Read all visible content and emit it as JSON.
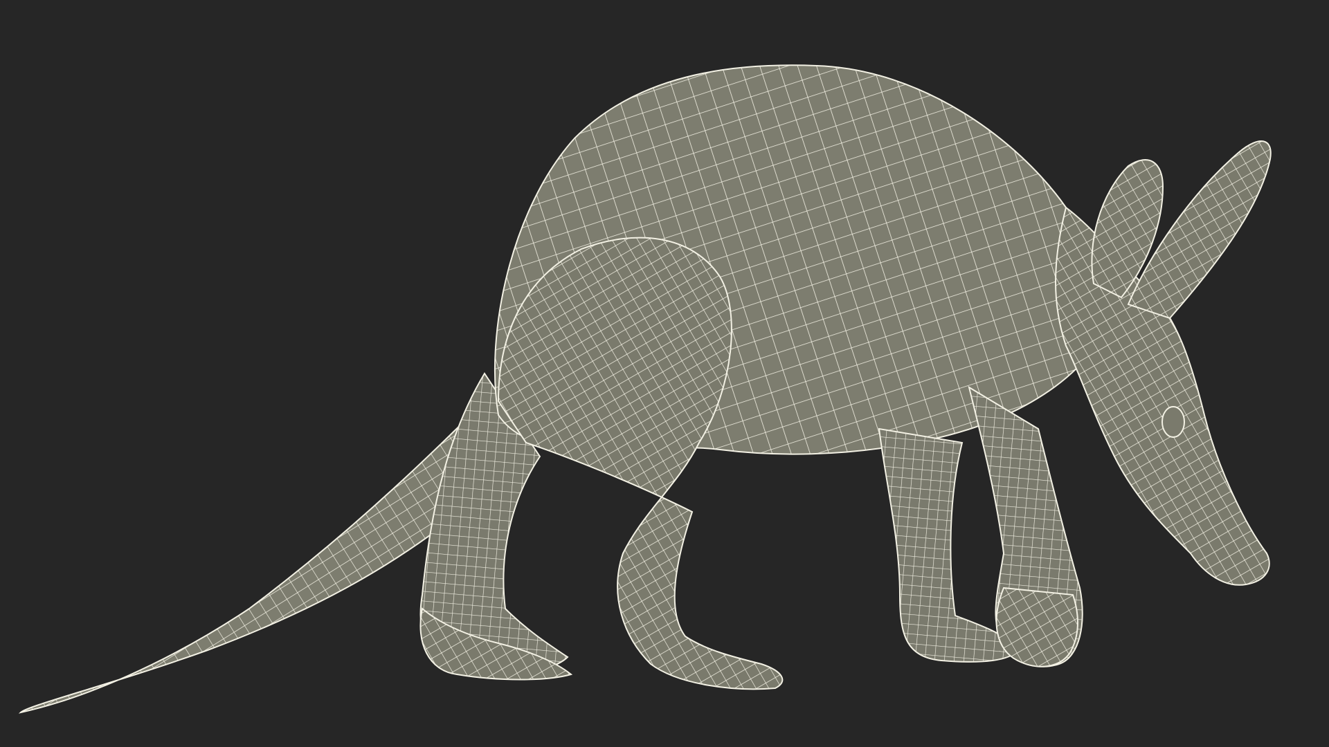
{
  "scene": {
    "subject": "aardvark",
    "style": "wireframe",
    "colors": {
      "background": "#262626",
      "surface": "#7d7d6f",
      "surface_shadow": "#6e6e62",
      "wire": "#f3f1e4"
    }
  }
}
